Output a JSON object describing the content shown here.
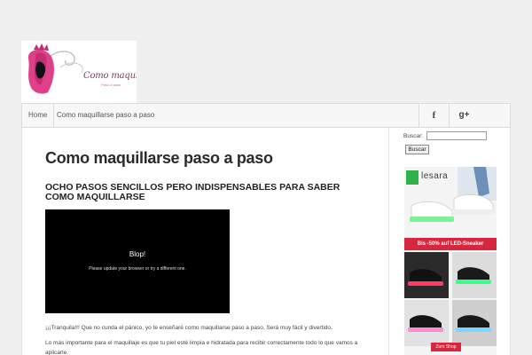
{
  "logo": {
    "title": "Como maquillarse",
    "subtitle": "Paso a paso"
  },
  "nav": {
    "home": "Home",
    "current": "Como maquillarse paso a paso",
    "social": [
      {
        "icon": "facebook-icon",
        "label": "f"
      },
      {
        "icon": "google-plus-icon",
        "label": "g+"
      }
    ]
  },
  "post": {
    "title": "Como maquillarse paso a paso",
    "subtitle": "OCHO PASOS SENCILLOS PERO INDISPENSABLES PARA SABER COMO MAQUILLARSE",
    "video": {
      "title": "Blop!",
      "message": "Please update your browser or try a different one."
    },
    "paragraphs": [
      "¡¡¡Tranquila!!! Que no cunda el pánico, yo te enseñaré como maquillarse paso a paso. Será muy fácil y divertido.",
      "Lo más importante para el maquillaje es que tu piel esté limpia e hidratada para recibir correctamente todo lo que vamos a aplicarle."
    ]
  },
  "sidebar": {
    "search_label": "Buscar:",
    "search_value": "",
    "search_button": "Buscar"
  },
  "ad": {
    "brand": "lesara",
    "banner": "Bis -50% auf LED-Sneaker",
    "cta": "Zum Shop",
    "colors": {
      "brand_green": "#2fb24a",
      "banner_red": "#d6273f"
    }
  },
  "colors": {
    "page_bg": "#f0f0f0",
    "logo_accent": "#e0408a"
  }
}
